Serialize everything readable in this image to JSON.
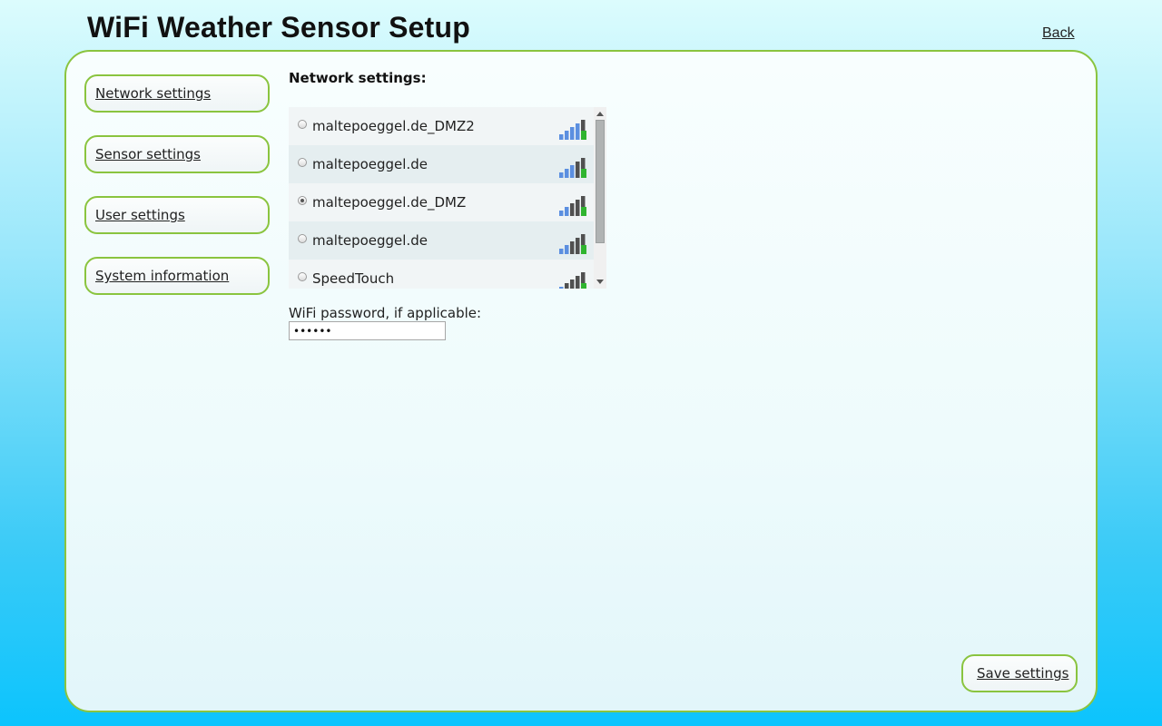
{
  "header": {
    "title": "WiFi Weather Sensor Setup",
    "back_label": "Back"
  },
  "nav": {
    "items": [
      {
        "label": "Network settings"
      },
      {
        "label": "Sensor settings"
      },
      {
        "label": "User settings"
      },
      {
        "label": "System information"
      }
    ]
  },
  "network": {
    "heading": "Network settings:",
    "networks": [
      {
        "ssid": "maltepoeggel.de_DMZ2",
        "selected": false,
        "signal_bars": 4,
        "secured": true
      },
      {
        "ssid": "maltepoeggel.de",
        "selected": false,
        "signal_bars": 3,
        "secured": true
      },
      {
        "ssid": "maltepoeggel.de_DMZ",
        "selected": true,
        "signal_bars": 2,
        "secured": true
      },
      {
        "ssid": "maltepoeggel.de",
        "selected": false,
        "signal_bars": 2,
        "secured": true
      },
      {
        "ssid": "SpeedTouch",
        "selected": false,
        "signal_bars": 1,
        "secured": true
      }
    ],
    "password_label": "WiFi password, if applicable:",
    "password_value": "••••••"
  },
  "actions": {
    "save_label": "Save settings"
  },
  "colors": {
    "accent_border": "#8ac43f",
    "signal_active": "#5b8fe0",
    "signal_inactive": "#505050",
    "lock_badge": "#2fb42f"
  }
}
